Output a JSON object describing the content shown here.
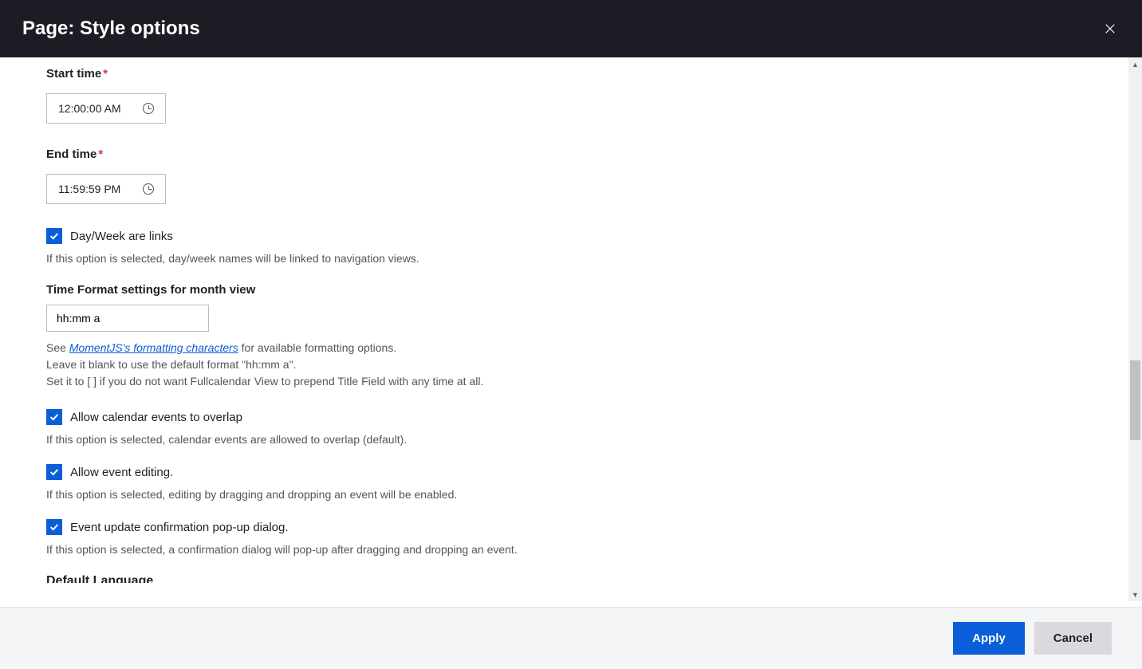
{
  "header": {
    "title": "Page: Style options"
  },
  "fields": {
    "start_time": {
      "label": "Start time",
      "value": "12:00:00 AM"
    },
    "end_time": {
      "label": "End time",
      "value": "11:59:59 PM"
    },
    "day_week_links": {
      "label": "Day/Week are links",
      "help": "If this option is selected, day/week names will be linked to navigation views."
    },
    "time_format": {
      "label": "Time Format settings for month view",
      "value": "hh:mm a",
      "help_prefix": "See ",
      "help_link": "MomentJS's formatting characters",
      "help_suffix": " for available formatting options.",
      "help_line2": "Leave it blank to use the default format \"hh:mm a\".",
      "help_line3": "Set it to [ ] if you do not want Fullcalendar View to prepend Title Field with any time at all."
    },
    "allow_overlap": {
      "label": "Allow calendar events to overlap",
      "help": "If this option is selected, calendar events are allowed to overlap (default)."
    },
    "allow_editing": {
      "label": "Allow event editing.",
      "help": "If this option is selected, editing by dragging and dropping an event will be enabled."
    },
    "confirm_popup": {
      "label": "Event update confirmation pop-up dialog.",
      "help": "If this option is selected, a confirmation dialog will pop-up after dragging and dropping an event."
    },
    "default_language": {
      "label": "Default Language"
    }
  },
  "footer": {
    "apply": "Apply",
    "cancel": "Cancel"
  }
}
